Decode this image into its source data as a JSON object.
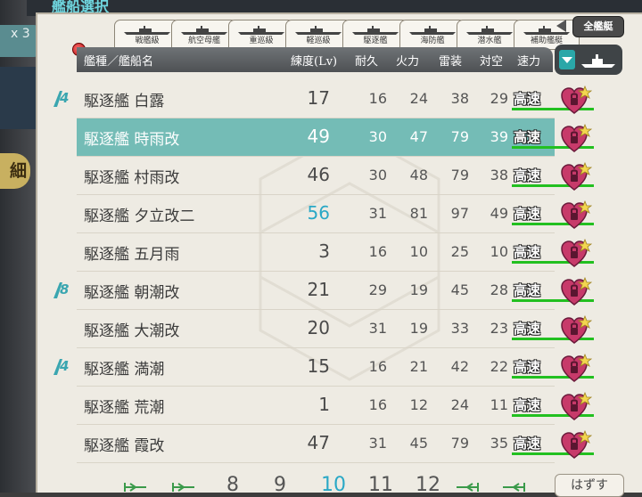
{
  "header": {
    "title": "艦船選択"
  },
  "left": {
    "count_label": "x 3",
    "detail_label": "細"
  },
  "tabs": [
    {
      "label": "戦艦級"
    },
    {
      "label": "航空母艦"
    },
    {
      "label": "重巡級"
    },
    {
      "label": "軽巡級"
    },
    {
      "label": "駆逐艦"
    },
    {
      "label": "海防艦"
    },
    {
      "label": "潜水艦"
    },
    {
      "label": "補助艦艇"
    }
  ],
  "all_ships_label": "全艦艇",
  "columns": {
    "name": "艦種／艦船名",
    "lv": "練度(Lv)",
    "hp": "耐久",
    "fp": "火力",
    "torp": "雷装",
    "aa": "対空",
    "speed": "速力"
  },
  "rows": [
    {
      "name": "駆逐艦 白露",
      "lv": "17",
      "hp": "16",
      "fp": "24",
      "torp": "38",
      "aa": "29",
      "speed": "高速",
      "badge": "4",
      "selected": false,
      "lv_married": false
    },
    {
      "name": "駆逐艦 時雨改",
      "lv": "49",
      "hp": "30",
      "fp": "47",
      "torp": "79",
      "aa": "39",
      "speed": "高速",
      "badge": "",
      "selected": true,
      "lv_married": false
    },
    {
      "name": "駆逐艦 村雨改",
      "lv": "46",
      "hp": "30",
      "fp": "48",
      "torp": "79",
      "aa": "38",
      "speed": "高速",
      "badge": "",
      "selected": false,
      "lv_married": false
    },
    {
      "name": "駆逐艦 夕立改二",
      "lv": "56",
      "hp": "31",
      "fp": "81",
      "torp": "97",
      "aa": "49",
      "speed": "高速",
      "badge": "",
      "selected": false,
      "lv_married": true
    },
    {
      "name": "駆逐艦 五月雨",
      "lv": "3",
      "hp": "16",
      "fp": "10",
      "torp": "25",
      "aa": "10",
      "speed": "高速",
      "badge": "",
      "selected": false,
      "lv_married": false
    },
    {
      "name": "駆逐艦 朝潮改",
      "lv": "21",
      "hp": "29",
      "fp": "19",
      "torp": "45",
      "aa": "28",
      "speed": "高速",
      "badge": "8",
      "selected": false,
      "lv_married": false
    },
    {
      "name": "駆逐艦 大潮改",
      "lv": "20",
      "hp": "31",
      "fp": "19",
      "torp": "33",
      "aa": "23",
      "speed": "高速",
      "badge": "",
      "selected": false,
      "lv_married": false
    },
    {
      "name": "駆逐艦 満潮",
      "lv": "15",
      "hp": "16",
      "fp": "21",
      "torp": "42",
      "aa": "22",
      "speed": "高速",
      "badge": "4",
      "selected": false,
      "lv_married": false
    },
    {
      "name": "駆逐艦 荒潮",
      "lv": "1",
      "hp": "16",
      "fp": "12",
      "torp": "24",
      "aa": "11",
      "speed": "高速",
      "badge": "",
      "selected": false,
      "lv_married": false
    },
    {
      "name": "駆逐艦 霞改",
      "lv": "47",
      "hp": "31",
      "fp": "45",
      "torp": "79",
      "aa": "35",
      "speed": "高速",
      "badge": "",
      "selected": false,
      "lv_married": false
    }
  ],
  "pager": {
    "pages": [
      "8",
      "9",
      "10",
      "11",
      "12"
    ],
    "current": "10"
  },
  "remove_label": "はずす",
  "colors": {
    "accent": "#2aa8c6",
    "selected_row": "#74bcb6",
    "speed_bar": "#22c020",
    "heart": "#c73a6a"
  }
}
